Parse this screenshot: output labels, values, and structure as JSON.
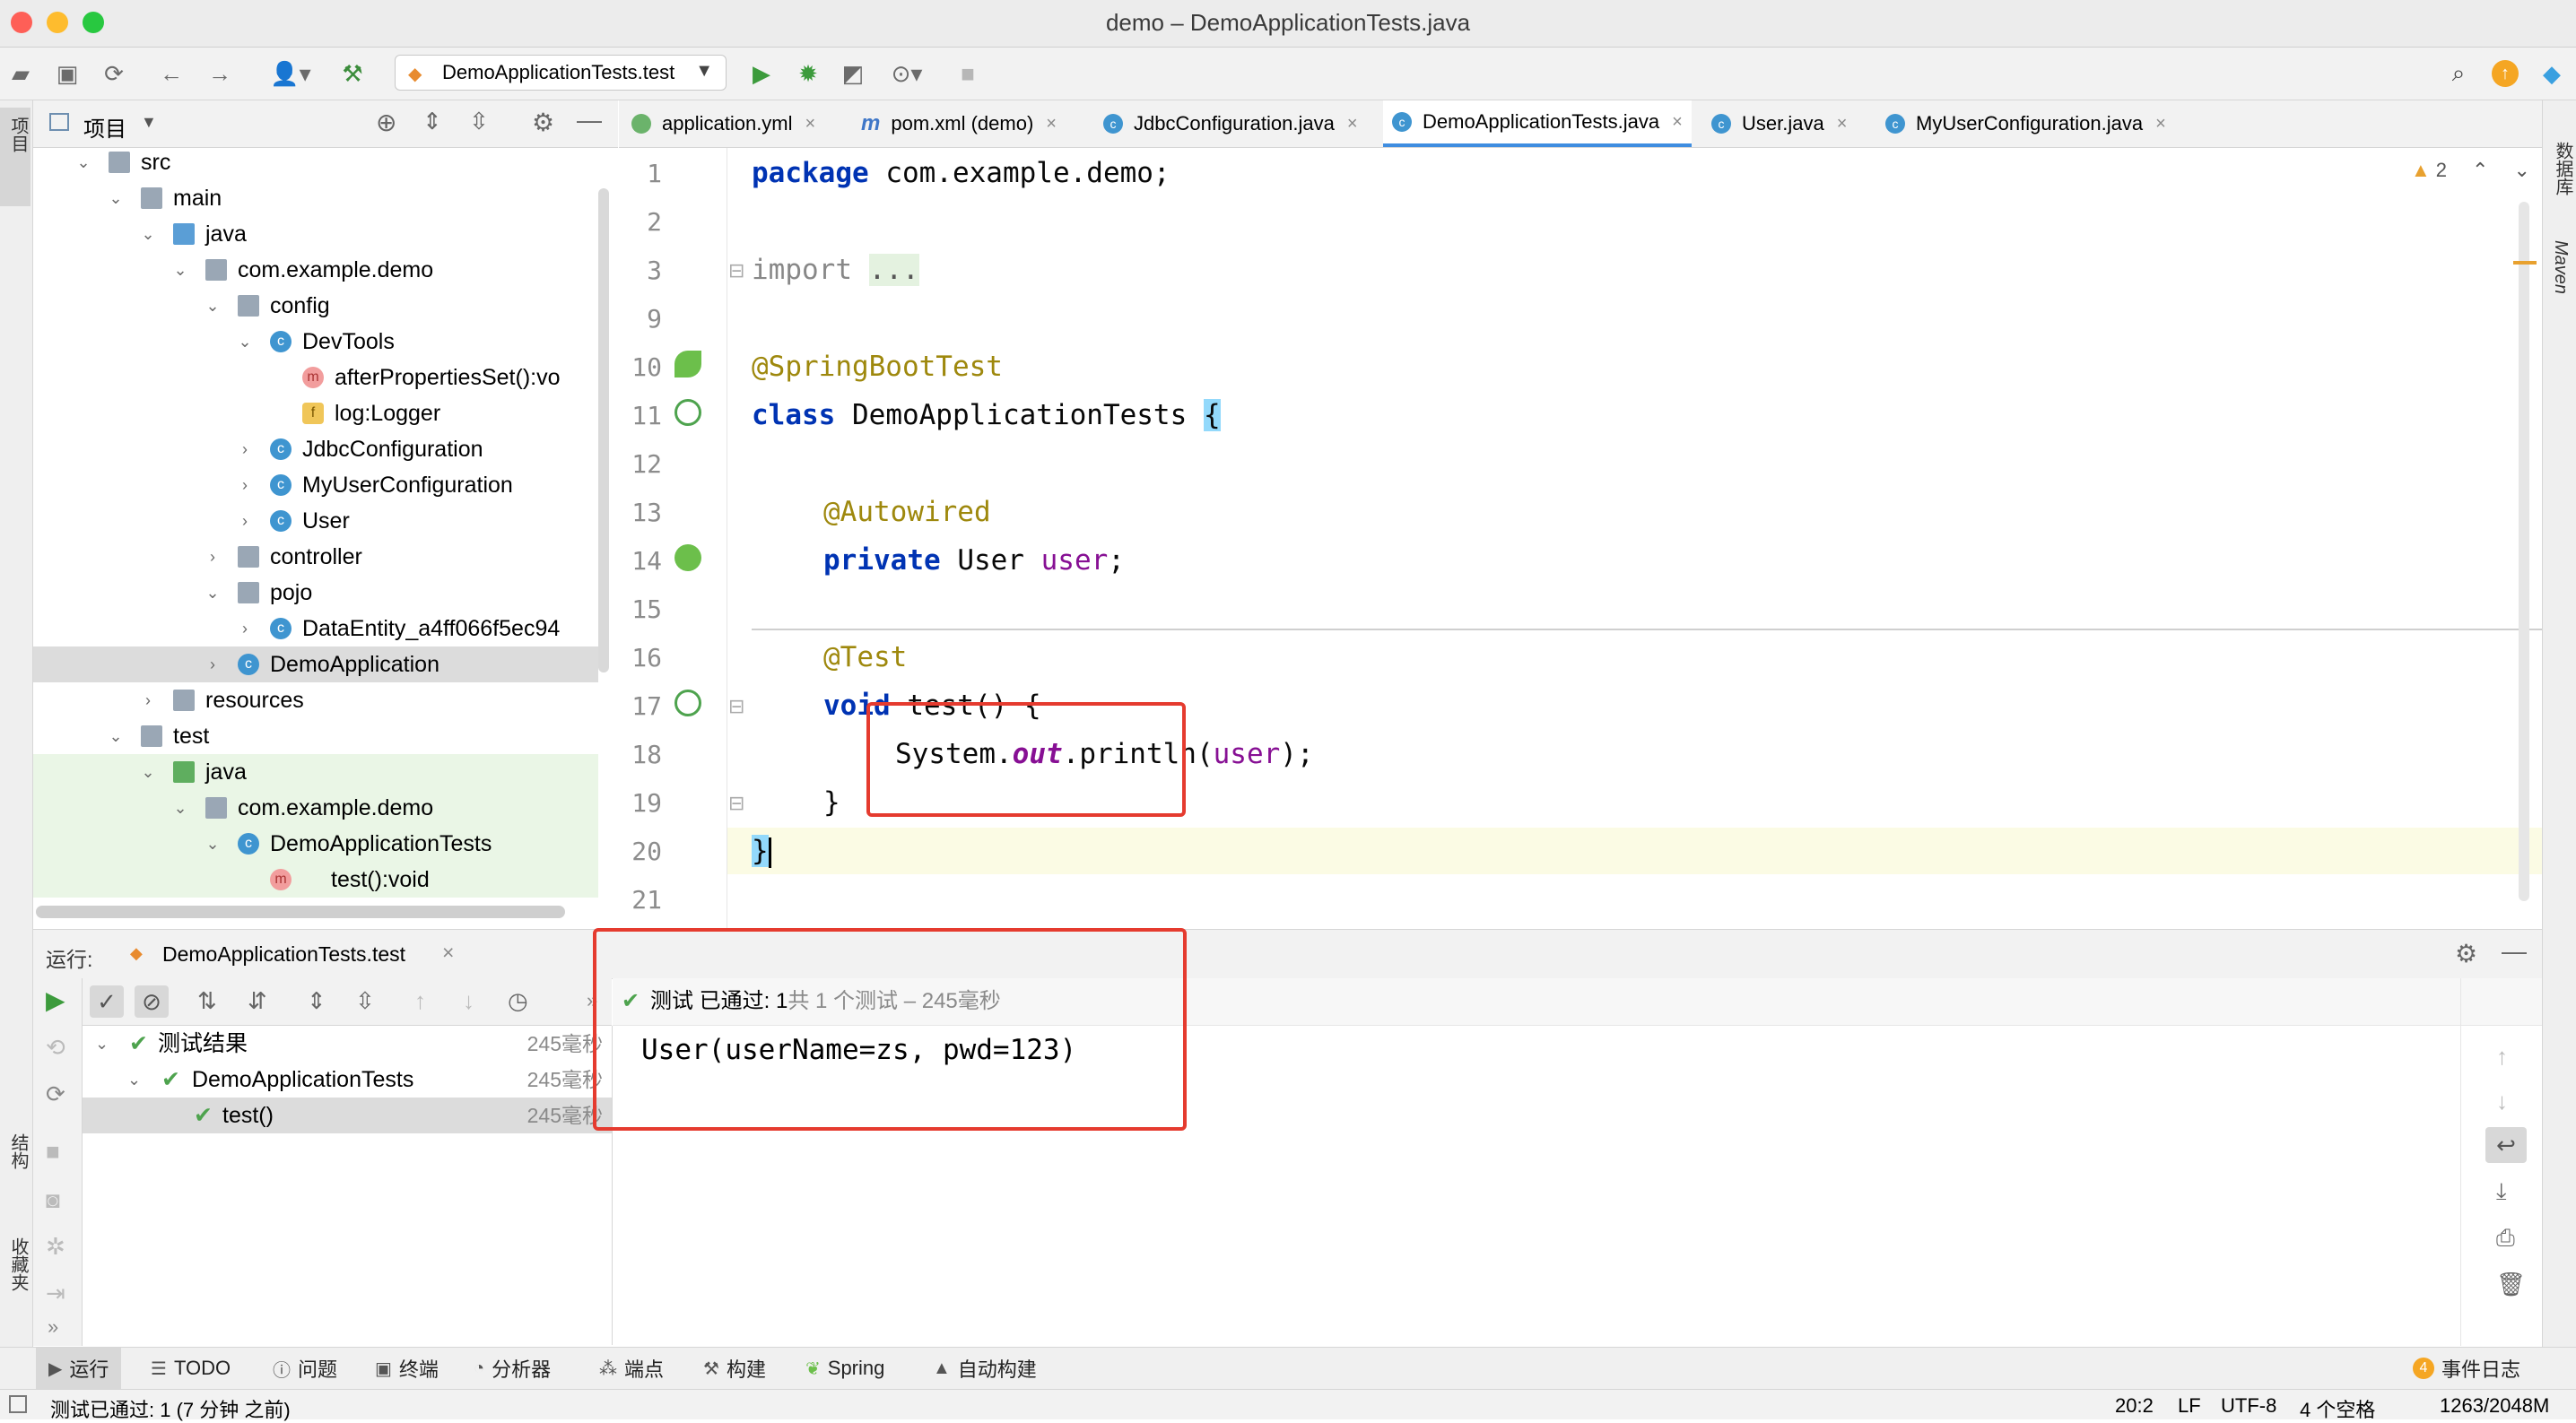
{
  "window": {
    "title": "demo – DemoApplicationTests.java"
  },
  "toolbar": {
    "run_config": "DemoApplicationTests.test"
  },
  "left_strip": {
    "project_label": "项目",
    "structure_label": "结构",
    "favorites_label": "收藏夹"
  },
  "right_strip": {
    "database_label": "数据库",
    "maven_label": "Maven"
  },
  "project_panel": {
    "title": "项目",
    "tree": [
      {
        "label": "src",
        "type": "folder"
      },
      {
        "label": "main",
        "type": "folder"
      },
      {
        "label": "java",
        "type": "folder-blue"
      },
      {
        "label": "com.example.demo",
        "type": "package"
      },
      {
        "label": "config",
        "type": "package"
      },
      {
        "label": "DevTools",
        "type": "class"
      },
      {
        "label": "afterPropertiesSet():vo",
        "type": "method"
      },
      {
        "label": "log:Logger",
        "type": "field"
      },
      {
        "label": "JdbcConfiguration",
        "type": "class"
      },
      {
        "label": "MyUserConfiguration",
        "type": "class"
      },
      {
        "label": "User",
        "type": "class"
      },
      {
        "label": "controller",
        "type": "package"
      },
      {
        "label": "pojo",
        "type": "package"
      },
      {
        "label": "DataEntity_a4ff066f5ec94",
        "type": "class"
      },
      {
        "label": "DemoApplication",
        "type": "class"
      },
      {
        "label": "resources",
        "type": "folder"
      },
      {
        "label": "test",
        "type": "folder"
      },
      {
        "label": "java",
        "type": "folder-green"
      },
      {
        "label": "com.example.demo",
        "type": "package"
      },
      {
        "label": "DemoApplicationTests",
        "type": "class"
      },
      {
        "label": "test():void",
        "type": "method"
      }
    ]
  },
  "editor_tabs": [
    {
      "label": "application.yml"
    },
    {
      "label": "pom.xml (demo)"
    },
    {
      "label": "JdbcConfiguration.java"
    },
    {
      "label": "DemoApplicationTests.java"
    },
    {
      "label": "User.java"
    },
    {
      "label": "MyUserConfiguration.java"
    }
  ],
  "editor": {
    "warnings": "2",
    "line_numbers": [
      "1",
      "2",
      "3",
      "9",
      "10",
      "11",
      "12",
      "13",
      "14",
      "15",
      "16",
      "17",
      "18",
      "19",
      "20",
      "21"
    ],
    "tokens": {
      "package_kw": "package",
      "package_name": " com.example.demo;",
      "import_kw": "import",
      "import_fold": "...",
      "springboottest": "@SpringBootTest",
      "class_kw": "class",
      "class_name": " DemoApplicationTests ",
      "brace_open": "{",
      "autowired": "@Autowired",
      "private_kw": "private",
      "user_type": " User ",
      "user_field": "user",
      "semicolon": ";",
      "test_ann": "@Test",
      "void_kw": "void",
      "test_sig": " test() {",
      "sys": "System.",
      "out": "out",
      ".println(": ".println(",
      "arg": "user",
      ");": ");",
      "close_inner": "}",
      "close_outer": "}"
    }
  },
  "run_panel": {
    "label": "运行:",
    "tab": "DemoApplicationTests.test",
    "status_prefix": "测试 已通过: ",
    "status_count": "1",
    "status_suffix": "共 1 个测试 – 245毫秒",
    "output": "User(userName=zs, pwd=123)",
    "tree": [
      {
        "label": "测试结果",
        "time": "245毫秒"
      },
      {
        "label": "DemoApplicationTests",
        "time": "245毫秒"
      },
      {
        "label": "test()",
        "time": "245毫秒"
      }
    ]
  },
  "bottom_tabs": [
    {
      "label": "运行",
      "icon": "play-icon"
    },
    {
      "label": "TODO",
      "icon": "list-icon"
    },
    {
      "label": "问题",
      "icon": "info-icon"
    },
    {
      "label": "终端",
      "icon": "terminal-icon"
    },
    {
      "label": "分析器",
      "icon": "profiler-icon"
    },
    {
      "label": "端点",
      "icon": "endpoints-icon"
    },
    {
      "label": "构建",
      "icon": "hammer-icon"
    },
    {
      "label": "Spring",
      "icon": "spring-icon"
    },
    {
      "label": "自动构建",
      "icon": "warning-icon"
    }
  ],
  "event_log": {
    "count": "4",
    "label": "事件日志"
  },
  "status_bar": {
    "message": "测试已通过: 1 (7 分钟 之前)",
    "position": "20:2",
    "line_sep": "LF",
    "encoding": "UTF-8",
    "indent": "4 个空格",
    "memory": "1263/2048M"
  }
}
